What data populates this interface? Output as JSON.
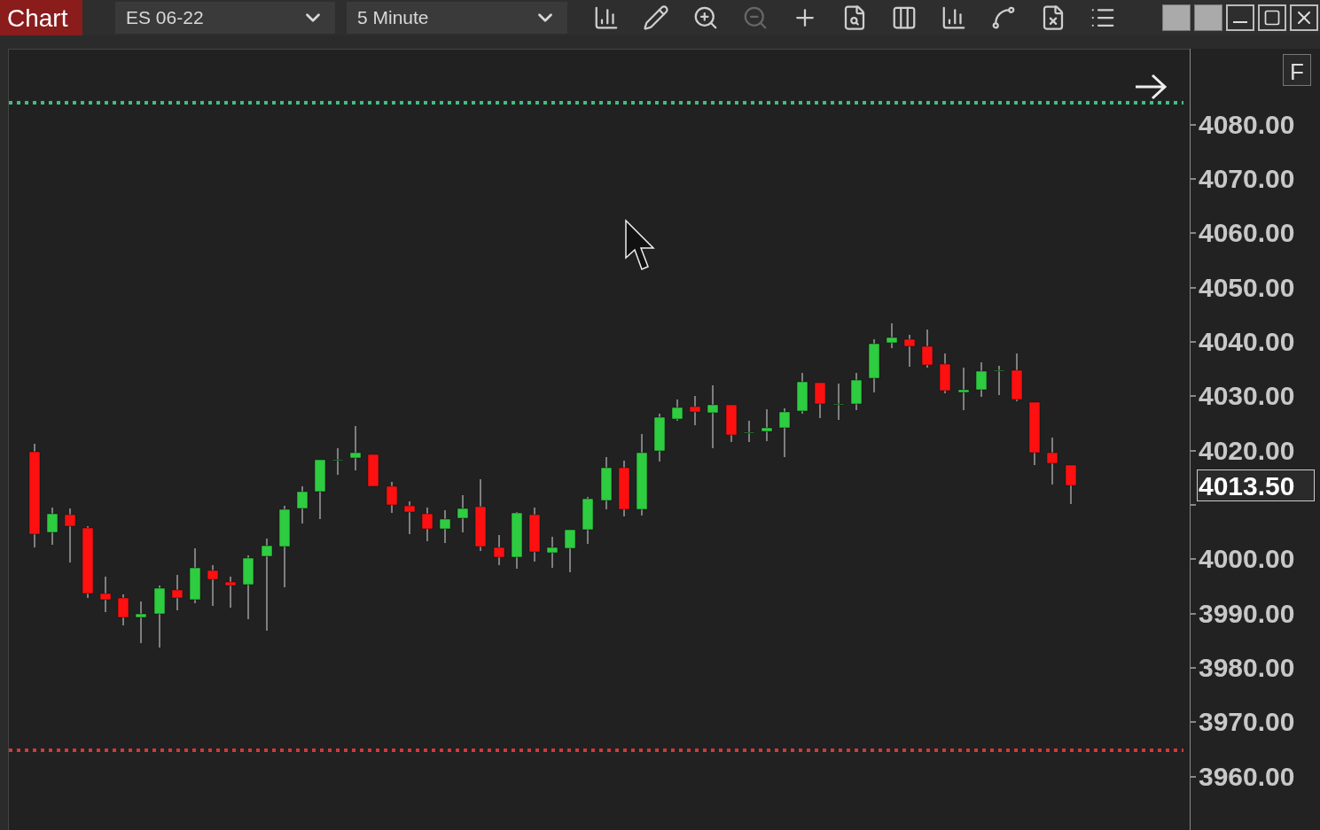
{
  "tab": {
    "label": "Chart",
    "selected": true
  },
  "instrument": {
    "value": "ES 06-22"
  },
  "interval": {
    "value": "5 Minute"
  },
  "toolbar": [
    {
      "kind": "bars",
      "disabled": false
    },
    {
      "kind": "draw",
      "disabled": false
    },
    {
      "kind": "zoom-in",
      "disabled": false
    },
    {
      "kind": "zoom-out",
      "disabled": true
    },
    {
      "kind": "crosshair",
      "disabled": false
    },
    {
      "kind": "data-box",
      "disabled": false
    },
    {
      "kind": "template",
      "disabled": false
    },
    {
      "kind": "indicators",
      "disabled": false
    },
    {
      "kind": "strategies",
      "disabled": false
    },
    {
      "kind": "properties",
      "disabled": false
    },
    {
      "kind": "list",
      "disabled": false
    }
  ],
  "chart": {
    "flag": "F",
    "current_price": "4013.50",
    "price_axis_above_marker": [
      "4080.00",
      "4070.00",
      "4060.00",
      "4050.00",
      "4040.00",
      "4030.00",
      "4020.00"
    ],
    "price_axis_below_marker": [
      "4000.00",
      "3990.00",
      "3980.00",
      "3970.00",
      "3960.00"
    ]
  }
}
